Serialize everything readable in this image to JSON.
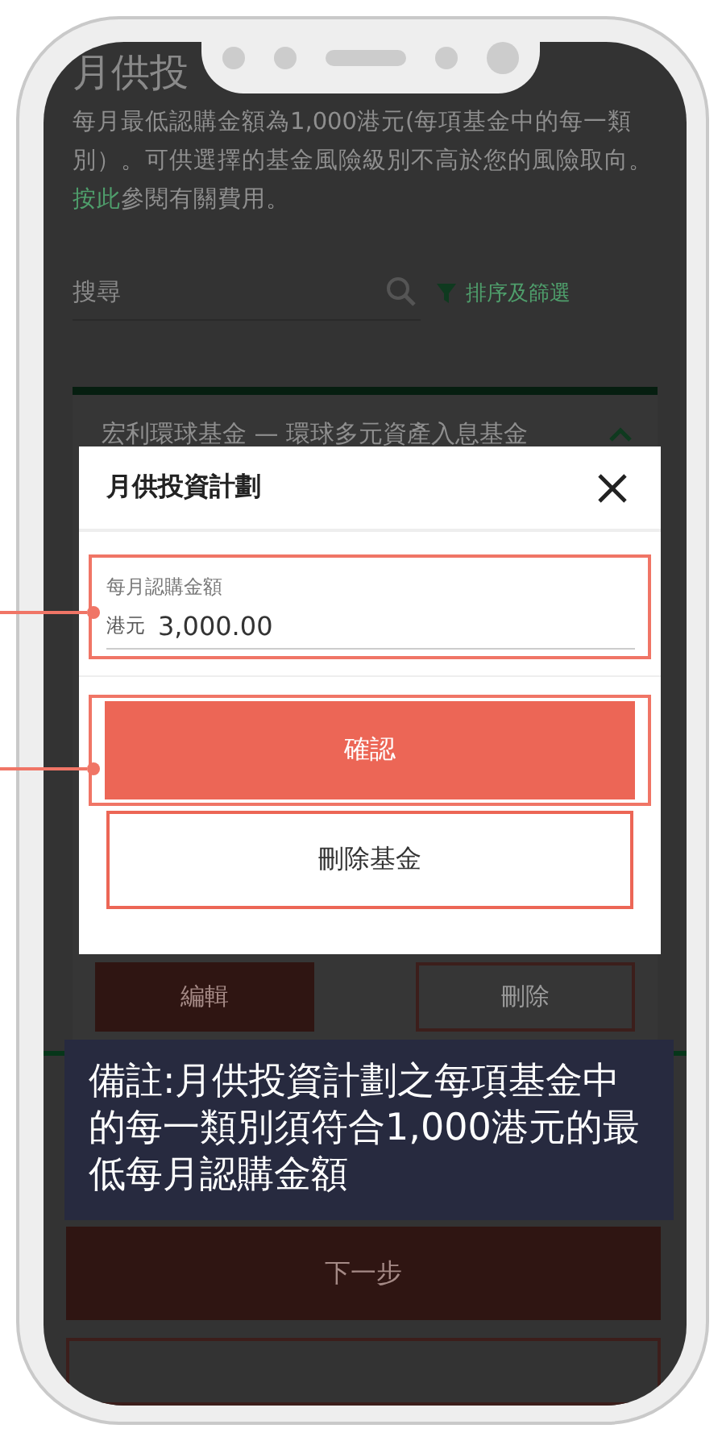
{
  "page": {
    "title": "月供投",
    "intro_before": "每月最低認購金額為1,000港元(每項基金中的每一類別）。可供選擇的基金風險級別不高於您的風險取向。",
    "intro_link": "按此",
    "intro_after": "參閱有關費用。"
  },
  "search": {
    "placeholder": "搜尋"
  },
  "sort_filter": "排序及篩選",
  "fund_card": {
    "name": "宏利環球基金 — 環球多元資產入息基金",
    "expanded": true,
    "buttons": [
      {
        "label": "編輯",
        "kind": "filled"
      },
      {
        "label": "刪除",
        "kind": "outline"
      }
    ]
  },
  "next_button": "下一步",
  "modal": {
    "title": "月供投資計劃",
    "field": {
      "label": "每月認購金額",
      "prefix": "港元",
      "value": "3,000.00"
    },
    "confirm": "確認",
    "delete": "刪除基金"
  },
  "note": "備註:月供投資計劃之每項基金中的每一類別須符合1,000港元的最低每月認購金額"
}
